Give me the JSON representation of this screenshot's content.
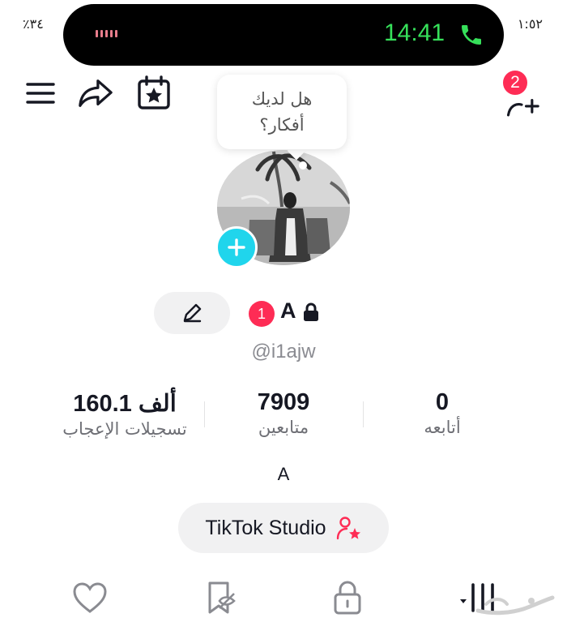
{
  "status": {
    "battery_text": "٪٣٤",
    "time_text": "١:٥٢",
    "call_time": "14:41"
  },
  "header": {
    "menu_icon": "hamburger-icon",
    "share_icon": "share-arrow-icon",
    "events_icon": "calendar-star-icon",
    "add_friend_icon": "add-person-icon",
    "add_friend_badge": "2"
  },
  "tooltip": {
    "line1": "هل لديك",
    "line2": "أفكار؟"
  },
  "profile": {
    "name": "A",
    "name_badge": "1",
    "handle": "@i1ajw",
    "bio": "A"
  },
  "stats": {
    "likes_value": "160.1 ألف",
    "likes_label": "تسجيلات الإعجاب",
    "followers_value": "7909",
    "followers_label": "متابعين",
    "following_value": "0",
    "following_label": "أتابعه"
  },
  "actions": {
    "studio_label": "TikTok Studio"
  },
  "tabs": [
    "heart-icon",
    "bookmark-hidden-icon",
    "lock-icon",
    "grid-icon"
  ],
  "colors": {
    "accent": "#fe2c55",
    "avatar_add": "#20d5ec",
    "call_green": "#36e05a"
  }
}
